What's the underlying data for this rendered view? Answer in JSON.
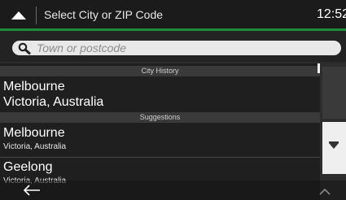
{
  "header": {
    "title": "Select City or ZIP Code",
    "clock": "12:52",
    "up_icon": "triangle-up-icon"
  },
  "search": {
    "placeholder": "Town or postcode",
    "icon": "search-icon"
  },
  "sections": [
    {
      "label": "City History",
      "items": [
        {
          "name": "Melbourne",
          "region": "Victoria, Australia"
        }
      ]
    },
    {
      "label": "Suggestions",
      "items": [
        {
          "name": "Melbourne",
          "region": "Victoria, Australia"
        },
        {
          "name": "Geelong",
          "region": "Victoria, Australia"
        }
      ]
    }
  ],
  "footer": {
    "back_icon": "back-arrow-icon",
    "more_icon": "chevron-up-icon"
  },
  "colors": {
    "accent": "#1f8a3e",
    "background": "#2b2b2b"
  }
}
